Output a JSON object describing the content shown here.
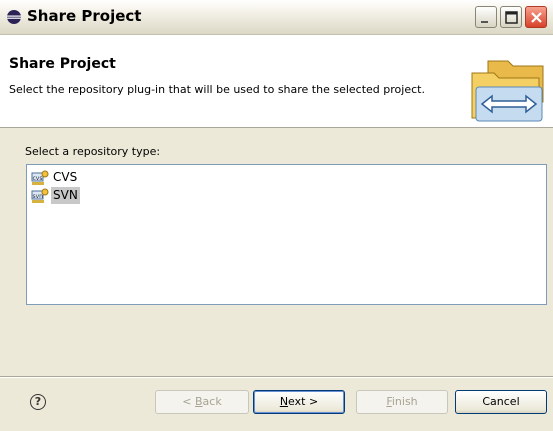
{
  "window": {
    "title": "Share Project"
  },
  "header": {
    "title": "Share Project",
    "description": "Select the repository plug-in that will be used to share the selected project."
  },
  "content": {
    "select_label": "Select a repository type:",
    "repository_types": [
      {
        "label": "CVS",
        "icon": "cvs-repository-icon",
        "selected": false
      },
      {
        "label": "SVN",
        "icon": "svn-repository-icon",
        "selected": true
      }
    ]
  },
  "buttons": {
    "help": "?",
    "back": {
      "prefix": "< ",
      "mnemonic": "B",
      "rest": "ack",
      "enabled": false
    },
    "next": {
      "mnemonic": "N",
      "rest": "ext >",
      "enabled": true
    },
    "finish": {
      "mnemonic": "F",
      "rest": "inish",
      "enabled": false
    },
    "cancel": "Cancel"
  },
  "colors": {
    "selection": "#c8c8c8",
    "dialog_bg": "#ece9d8",
    "list_border": "#7f9db9"
  }
}
